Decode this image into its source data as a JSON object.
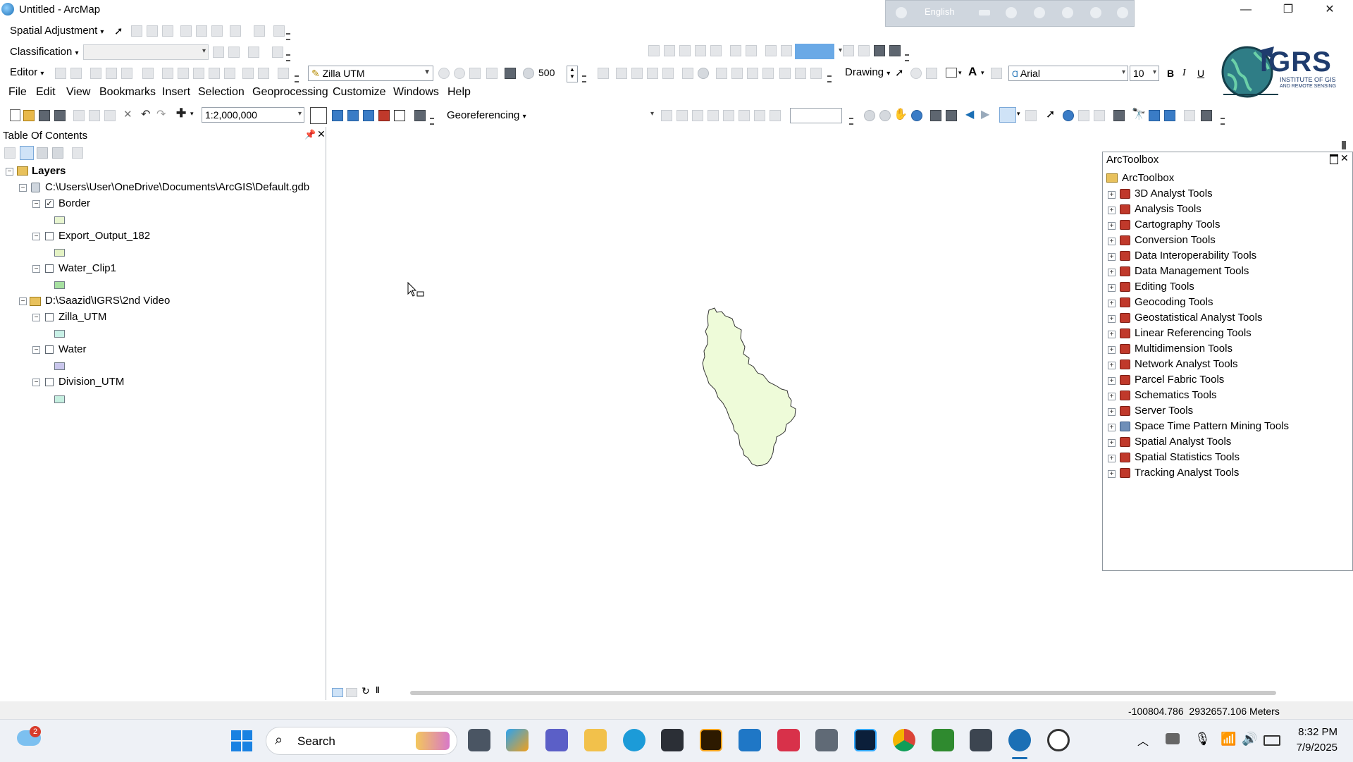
{
  "window": {
    "title": "Untitled - ArcMap",
    "minimize": "—",
    "maximize": "❐",
    "close": "✕"
  },
  "langbar": {
    "language": "English"
  },
  "toolbars": {
    "spatial_adjustment": "Spatial Adjustment",
    "classification": "Classification",
    "editor": "Editor",
    "layer_combo": "Zilla UTM",
    "resolution": "500",
    "drawing": "Drawing",
    "font_name": "Arial",
    "font_size": "10",
    "bold": "B",
    "italic": "I",
    "underline": "U",
    "scale": "1:2,000,000",
    "georeferencing": "Georeferencing"
  },
  "logo": {
    "name": "IGRS",
    "subtitle_1": "INSTITUTE OF GIS",
    "subtitle_2": "AND REMOTE SENSING"
  },
  "menu": [
    "File",
    "Edit",
    "View",
    "Bookmarks",
    "Insert",
    "Selection",
    "Geoprocessing",
    "Customize",
    "Windows",
    "Help"
  ],
  "toc": {
    "title": "Table Of Contents",
    "root": "Layers",
    "groups": [
      {
        "label": "C:\\Users\\User\\OneDrive\\Documents\\ArcGIS\\Default.gdb",
        "layers": [
          {
            "name": "Border",
            "checked": true,
            "swatch": "#e8f5d0"
          },
          {
            "name": "Export_Output_182",
            "checked": false,
            "swatch": "#e4f2c4"
          },
          {
            "name": "Water_Clip1",
            "checked": false,
            "swatch": "#a6e0a0"
          }
        ]
      },
      {
        "label": "D:\\Saazid\\IGRS\\2nd Video",
        "layers": [
          {
            "name": "Zilla_UTM",
            "checked": false,
            "swatch": "#c8f0e6"
          },
          {
            "name": "Water",
            "checked": false,
            "swatch": "#c9c6ec"
          },
          {
            "name": "Division_UTM",
            "checked": false,
            "swatch": "#c6efe0"
          }
        ]
      }
    ]
  },
  "toolbox": {
    "title": "ArcToolbox",
    "root": "ArcToolbox",
    "items": [
      "3D Analyst Tools",
      "Analysis Tools",
      "Cartography Tools",
      "Conversion Tools",
      "Data Interoperability Tools",
      "Data Management Tools",
      "Editing Tools",
      "Geocoding Tools",
      "Geostatistical Analyst Tools",
      "Linear Referencing Tools",
      "Multidimension Tools",
      "Network Analyst Tools",
      "Parcel Fabric Tools",
      "Schematics Tools",
      "Server Tools",
      "Space Time Pattern Mining Tools",
      "Spatial Analyst Tools",
      "Spatial Statistics Tools",
      "Tracking Analyst Tools"
    ]
  },
  "status": {
    "coordinates": "-100804.786  2932657.106 Meters"
  },
  "taskbar": {
    "search": "Search",
    "time": "8:32 PM",
    "date": "7/9/2025",
    "notification_count": "2"
  },
  "colors": {
    "polygon_fill": "#eefbd9",
    "accent": "#1b6fb5",
    "toolbox_icon": "#c0392b"
  }
}
